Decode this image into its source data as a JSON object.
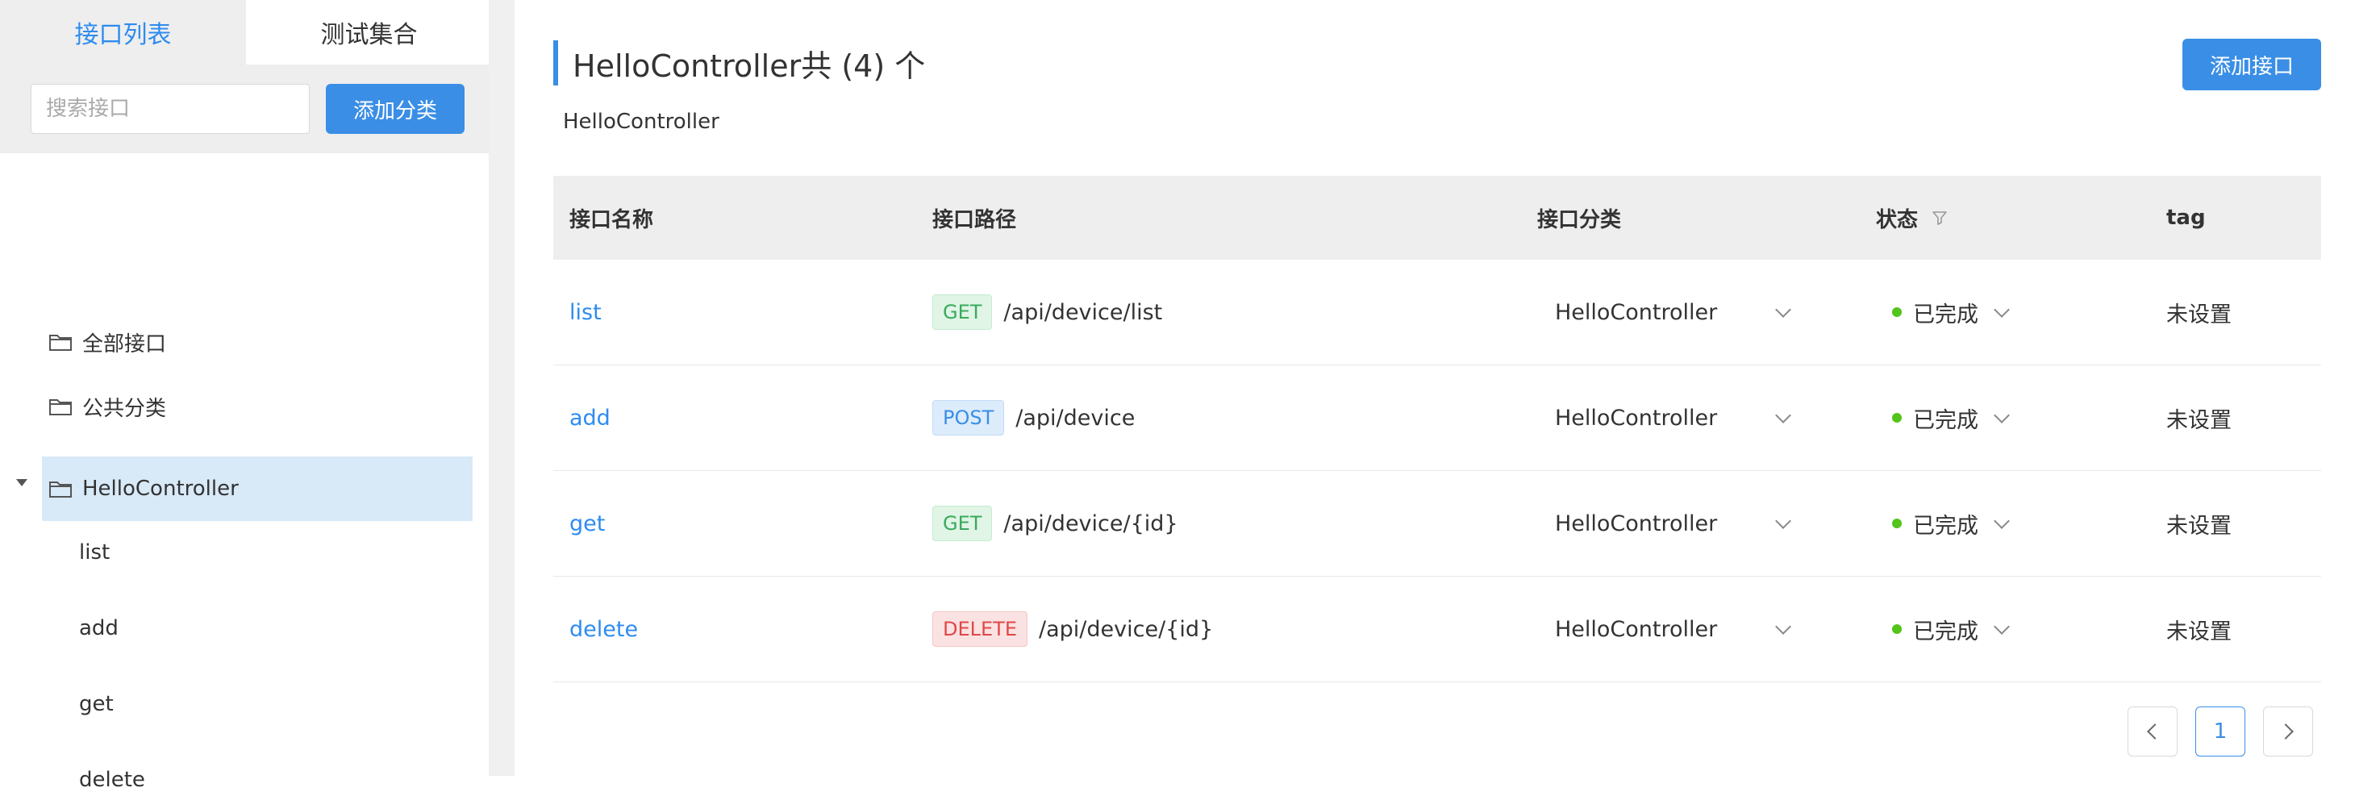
{
  "sidebar": {
    "tabs": [
      {
        "label": "接口列表",
        "active": true
      },
      {
        "label": "测试集合",
        "active": false
      }
    ],
    "search": {
      "placeholder": "搜索接口",
      "value": ""
    },
    "add_category_label": "添加分类",
    "tree": [
      {
        "label": "全部接口",
        "icon": "folder-icon"
      },
      {
        "label": "公共分类",
        "icon": "folder-icon"
      },
      {
        "label": "HelloController",
        "icon": "folder-icon",
        "expanded": true,
        "selected": true,
        "children": [
          "list",
          "add",
          "get",
          "delete"
        ]
      }
    ]
  },
  "main": {
    "title": "HelloController共 (4) 个",
    "subtitle": "HelloController",
    "add_api_label": "添加接口",
    "columns": [
      "接口名称",
      "接口路径",
      "接口分类",
      "状态",
      "tag"
    ],
    "rows": [
      {
        "name": "list",
        "method": "GET",
        "path": "/api/device/list",
        "category": "HelloController",
        "status": "已完成",
        "tag": "未设置"
      },
      {
        "name": "add",
        "method": "POST",
        "path": "/api/device",
        "category": "HelloController",
        "status": "已完成",
        "tag": "未设置"
      },
      {
        "name": "get",
        "method": "GET",
        "path": "/api/device/{id}",
        "category": "HelloController",
        "status": "已完成",
        "tag": "未设置"
      },
      {
        "name": "delete",
        "method": "DELETE",
        "path": "/api/device/{id}",
        "category": "HelloController",
        "status": "已完成",
        "tag": "未设置"
      }
    ],
    "pagination": {
      "current_page": "1"
    }
  },
  "colors": {
    "accent": "#3a8ee6",
    "link": "#2d8cf0",
    "status_done": "#52c41a",
    "get": "#3aaa5c",
    "post": "#3a8ee6",
    "delete": "#e04848"
  }
}
